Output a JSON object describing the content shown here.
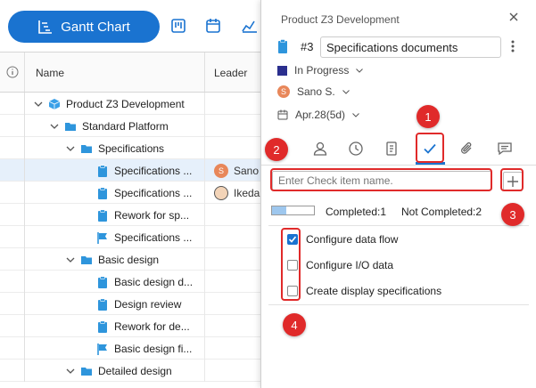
{
  "toolbar": {
    "gantt_chart_label": "Gantt Chart"
  },
  "table": {
    "header_name": "Name",
    "header_leader": "Leader",
    "rows": [
      {
        "label": "Product Z3 Development",
        "type": "cube",
        "leader": ""
      },
      {
        "label": "Standard Platform",
        "type": "folder",
        "leader": ""
      },
      {
        "label": "Specifications",
        "type": "folder",
        "leader": ""
      },
      {
        "label": "Specifications ...",
        "type": "clip",
        "leader": "Sano"
      },
      {
        "label": "Specifications ...",
        "type": "clip",
        "leader": "Ikeda"
      },
      {
        "label": "Rework for sp...",
        "type": "clip",
        "leader": ""
      },
      {
        "label": "Specifications ...",
        "type": "flag",
        "leader": ""
      },
      {
        "label": "Basic design",
        "type": "folder",
        "leader": ""
      },
      {
        "label": "Basic design d...",
        "type": "clip",
        "leader": ""
      },
      {
        "label": "Design review",
        "type": "clip",
        "leader": ""
      },
      {
        "label": "Rework for de...",
        "type": "clip",
        "leader": ""
      },
      {
        "label": "Basic design fi...",
        "type": "flag",
        "leader": ""
      },
      {
        "label": "Detailed design",
        "type": "folder",
        "leader": ""
      }
    ],
    "avatar_s": "S"
  },
  "panel": {
    "project": "Product Z3 Development",
    "task_number": "#3",
    "task_name": "Specifications documents",
    "status": "In Progress",
    "assignee": "Sano S.",
    "assignee_initial": "S",
    "date": "Apr.28(5d)",
    "checklist": {
      "placeholder": "Enter Check item name.",
      "completed_label": "Completed:1",
      "not_completed_label": "Not Completed:2",
      "progress": 0.33,
      "items": [
        {
          "label": "Configure data flow",
          "checked": true
        },
        {
          "label": "Configure I/O data",
          "checked": false
        },
        {
          "label": "Create display specifications",
          "checked": false
        }
      ]
    }
  },
  "callouts": {
    "c1": "1",
    "c2": "2",
    "c3": "3",
    "c4": "4"
  },
  "colors": {
    "accent": "#1a73d0",
    "callout": "#e02a2a",
    "status": "#2b2f8e"
  }
}
